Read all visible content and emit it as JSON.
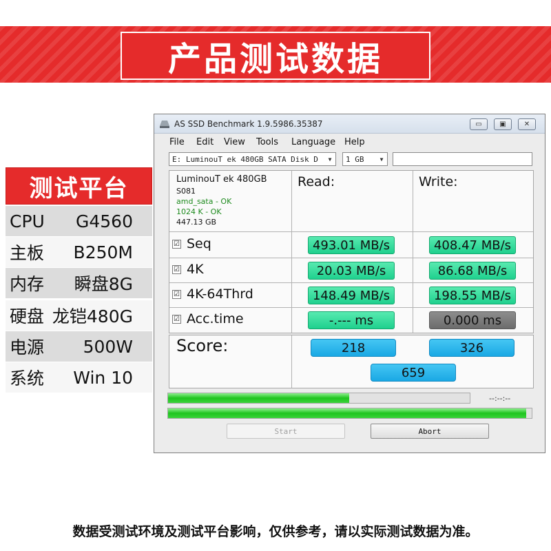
{
  "banner": {
    "title": "产品测试数据"
  },
  "specs": {
    "header": "测试平台",
    "rows": [
      {
        "key": "CPU",
        "value": "G4560"
      },
      {
        "key": "主板",
        "value": "B250M"
      },
      {
        "key": "内存",
        "value": "瞬盘8G"
      },
      {
        "key": "硬盘",
        "value": "龙铠480G"
      },
      {
        "key": "电源",
        "value": "500W"
      },
      {
        "key": "系统",
        "value": "Win 10"
      }
    ]
  },
  "window": {
    "title": "AS SSD Benchmark 1.9.5986.35387",
    "controls": {
      "minimize": "▭",
      "restore": "▣",
      "close": "✕"
    },
    "menu": [
      "File",
      "Edit",
      "View",
      "Tools",
      "Language",
      "Help"
    ],
    "drive_select": "E: LuminouT ek   480GB SATA Disk D",
    "size_select": "1 GB",
    "drive_info": {
      "name": "LuminouT ek    480GB",
      "firmware": "S081",
      "driver": "amd_sata - OK",
      "alignment": "1024 K - OK",
      "capacity": "447.13 GB"
    },
    "columns": {
      "read": "Read:",
      "write": "Write:"
    },
    "tests": [
      {
        "label": "Seq",
        "checked": "☑",
        "read": "493.01 MB/s",
        "write": "408.47 MB/s"
      },
      {
        "label": "4K",
        "checked": "☑",
        "read": "20.03 MB/s",
        "write": "86.68 MB/s"
      },
      {
        "label": "4K-64Thrd",
        "checked": "☑",
        "read": "148.49 MB/s",
        "write": "198.55 MB/s"
      },
      {
        "label": "Acc.time",
        "checked": "☑",
        "read": "-.--- ms",
        "write": "0.000 ms"
      }
    ],
    "score": {
      "label": "Score:",
      "read": "218",
      "write": "326",
      "total": "659"
    },
    "progress": {
      "current": 0.6,
      "total": 0.985,
      "time": "--:--:--"
    },
    "buttons": {
      "start": "Start",
      "abort": "Abort"
    }
  },
  "footer": "数据受测试环境及测试平台影响，仅供参考，请以实际测试数据为准。",
  "colors": {
    "brand_red": "#e52b2b",
    "green": "#1fd08e",
    "blue": "#1aa8e4"
  }
}
